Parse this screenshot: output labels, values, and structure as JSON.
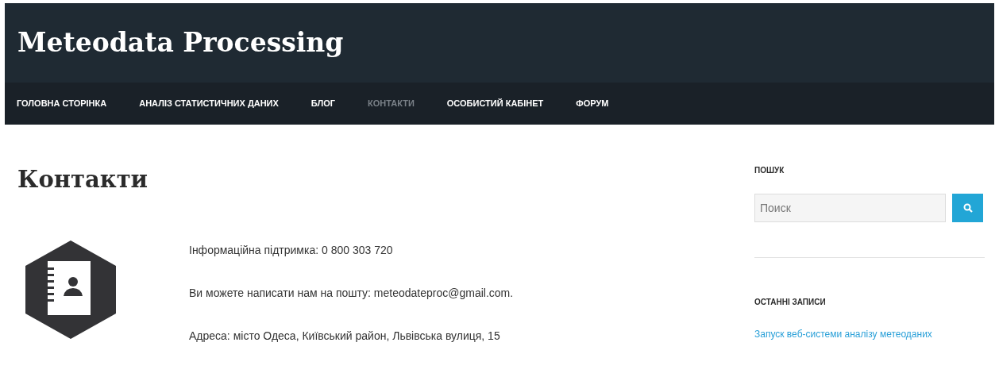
{
  "site_title": "Meteodata Processing",
  "nav": [
    {
      "label": "ГОЛОВНА СТОРІНКА",
      "selected": false
    },
    {
      "label": "АНАЛІЗ СТАТИСТИЧНИХ ДАНИХ",
      "selected": false
    },
    {
      "label": "БЛОГ",
      "selected": false
    },
    {
      "label": "КОНТАКТИ",
      "selected": true
    },
    {
      "label": "ОСОБИСТИЙ КАБІНЕТ",
      "selected": false
    },
    {
      "label": "ФОРУМ",
      "selected": false
    }
  ],
  "page_title": "Контакти",
  "contact_lines": [
    "Інформаційна підтримка: 0 800 303 720",
    "Ви можете написати нам на пошту: meteodateproc@gmail.com.",
    "Адреса: місто Одеса, Київський район, Львівська вулиця, 15"
  ],
  "sidebar": {
    "search_heading": "ПОШУК",
    "search": {
      "placeholder": "Поиск"
    },
    "recent_heading": "ОСТАННІ ЗАПИСИ",
    "recent_posts": [
      "Запуск веб-системи аналізу метеоданих"
    ]
  }
}
